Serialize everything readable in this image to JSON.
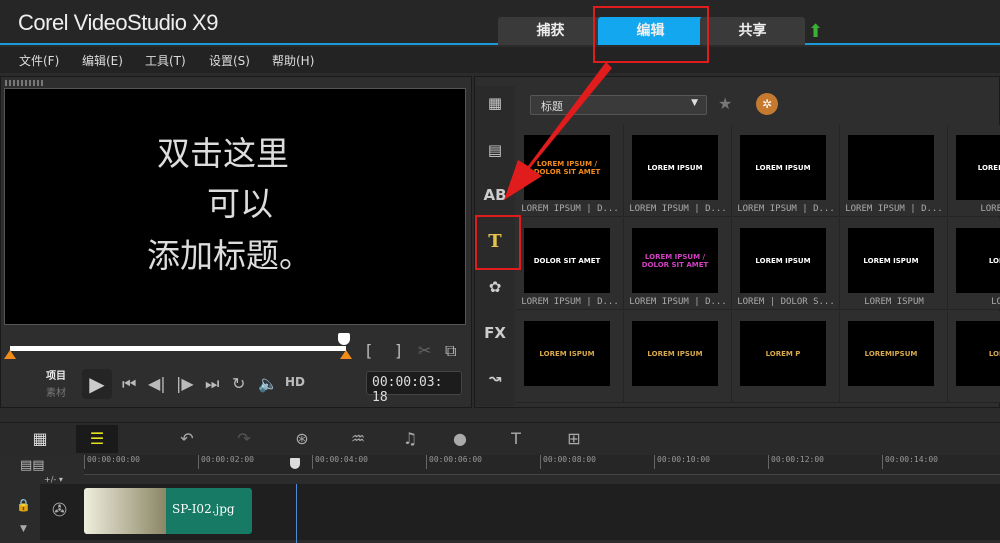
{
  "app": {
    "title": "Corel VideoStudio X9"
  },
  "tabs": [
    {
      "label": "捕获"
    },
    {
      "label": "编辑",
      "active": true
    },
    {
      "label": "共享"
    }
  ],
  "menu": [
    "文件(F)",
    "编辑(E)",
    "工具(T)",
    "设置(S)",
    "帮助(H)"
  ],
  "preview": {
    "lines": [
      "双击这里",
      "可以",
      "添加标题。"
    ],
    "mode_project": "项目",
    "mode_clip": "素材",
    "hd": "HD",
    "timecode": "00:00:03: 18"
  },
  "library": {
    "category": "标题",
    "items": [
      {
        "thumb": "LOREM IPSUM / DOLOR SIT AMET",
        "caption": "LOREM IPSUM | D..."
      },
      {
        "thumb": "LOREM IPSUM",
        "caption": "LOREM IPSUM | D..."
      },
      {
        "thumb": "LOREM IPSUM",
        "caption": "LOREM IPSUM | D..."
      },
      {
        "thumb": "",
        "caption": "LOREM IPSUM | D..."
      },
      {
        "thumb": "LOREM IPS",
        "caption": "LOREM IP"
      },
      {
        "thumb": "DOLOR SIT AMET",
        "caption": "LOREM IPSUM | D..."
      },
      {
        "thumb": "LOREM IPSUM / DOLOR SIT AMET",
        "caption": "LOREM IPSUM | D..."
      },
      {
        "thumb": "LOREM IPSUM",
        "caption": "LOREM | DOLOR S..."
      },
      {
        "thumb": "LOREM ISPUM",
        "caption": "LOREM ISPUM"
      },
      {
        "thumb": "LORE",
        "caption": "LORE"
      },
      {
        "thumb": "LOREM ISPUM",
        "caption": ""
      },
      {
        "thumb": "LOREM IPSUM",
        "caption": ""
      },
      {
        "thumb": "LOREM P",
        "caption": ""
      },
      {
        "thumb": "LOREMIPSUM",
        "caption": ""
      },
      {
        "thumb": "LORE",
        "caption": ""
      }
    ]
  },
  "timeline": {
    "ruler": [
      "00:00:00:00",
      "00:00:02:00",
      "00:00:04:00",
      "00:00:06:00",
      "00:00:08:00",
      "00:00:10:00",
      "00:00:12:00",
      "00:00:14:00"
    ],
    "track_mode": "+/- ▾",
    "clip": "SP-I02.jpg"
  },
  "colors": {
    "accent": "#12a7ee",
    "annotation": "#e01c1c",
    "clip": "#167a64"
  }
}
